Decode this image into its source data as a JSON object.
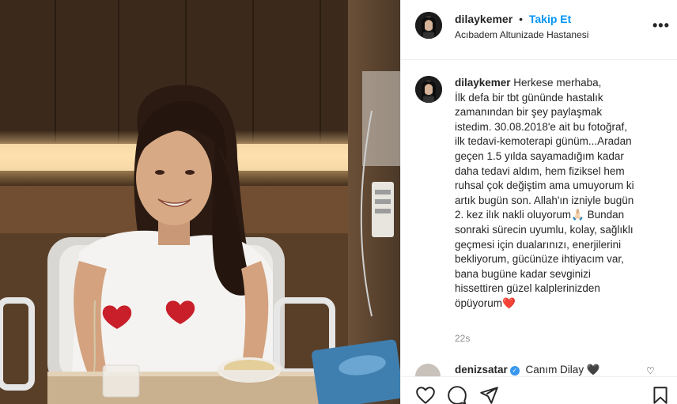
{
  "post": {
    "username": "dilaykemer",
    "dot": "•",
    "follow_label": "Takip Et",
    "location": "Acıbadem Altunizade Hastanesi",
    "more_label": "•••"
  },
  "caption": {
    "username": "dilaykemer",
    "text": " Herkese merhaba,\nİlk defa bir tbt gününde hastalık\nzamanından bir şey paylaşmak\nistedim. 30.08.2018'e ait bu fotoğraf,\nilk tedavi-kemoterapi günüm...Aradan\ngeçen 1.5 yılda sayamadığım kadar\ndaha tedavi aldım, hem fiziksel hem\nruhsal çok değiştim ama umuyorum ki\nartık bugün son. Allah'ın izniyle bugün\n2. kez ilık nakli oluyorum🙏🏻 Bundan\nsonraki sürecin uyumlu, kolay, sağlıklı\ngeçmesi için dualarınızı, enerjilerini\nbekliyorum, gücünüze ihtiyacım var,\nbana bugüne kadar sevginizi\nhissettiren güzel kalplerinizden\nöpüyorum",
    "heart": "❤️",
    "time": "22s"
  },
  "comment": {
    "username": "denizsatar",
    "verified_mark": "✓",
    "text": "Canım Dilay 🖤",
    "heart": "♡"
  },
  "actions": {
    "icons": [
      "heart-icon",
      "comment-icon",
      "share-icon",
      "bookmark-icon"
    ]
  },
  "colors": {
    "accent": "#0095f6",
    "text": "#262626",
    "muted": "#8e8e8e",
    "like": "#ed4956",
    "border": "#efefef"
  }
}
